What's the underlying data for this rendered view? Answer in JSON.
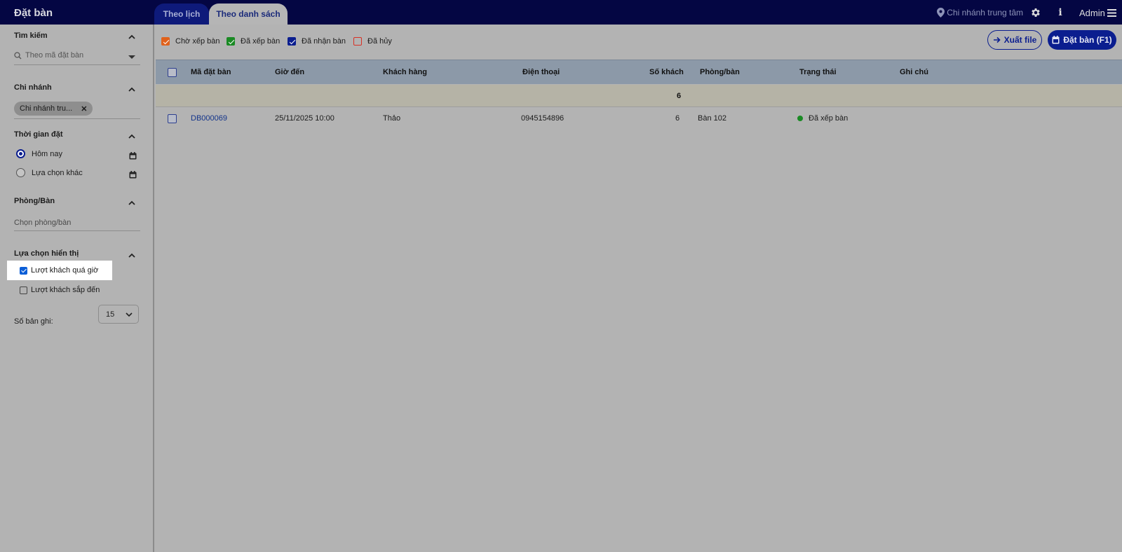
{
  "app": {
    "title": "Đặt bàn"
  },
  "tabs": [
    {
      "label": "Theo lịch",
      "active": false
    },
    {
      "label": "Theo danh sách",
      "active": true
    }
  ],
  "header": {
    "branch": "Chi nhánh trung tâm",
    "user": "Admin",
    "info_label": "i"
  },
  "sidebar": {
    "search": {
      "title": "Tìm kiếm",
      "placeholder": "Theo mã đặt bàn"
    },
    "branch": {
      "title": "Chi nhánh",
      "chip": "Chi nhánh tru..."
    },
    "time": {
      "title": "Thời gian đặt",
      "options": [
        {
          "label": "Hôm nay",
          "selected": true
        },
        {
          "label": "Lựa chọn khác",
          "selected": false
        }
      ]
    },
    "room": {
      "title": "Phòng/Bàn",
      "placeholder": "Chọn phòng/bàn"
    },
    "display": {
      "title": "Lựa chọn hiển thị",
      "options": [
        {
          "label": "Lượt khách quá giờ",
          "checked": true
        },
        {
          "label": "Lượt khách sắp đến",
          "checked": false
        }
      ]
    },
    "records": {
      "label": "Số bản ghi:",
      "value": "15"
    }
  },
  "status_filters": [
    {
      "label": "Chờ xếp bàn",
      "checked": true,
      "color": "#e0621c"
    },
    {
      "label": "Đã xếp bàn",
      "checked": true,
      "color": "#1a8a24"
    },
    {
      "label": "Đã nhận bàn",
      "checked": true,
      "color": "#0b1e8f"
    },
    {
      "label": "Đã hủy",
      "checked": false,
      "color": "#d93025"
    }
  ],
  "actions": {
    "export": "Xuất file",
    "book": "Đặt bàn (F1)"
  },
  "table": {
    "columns": [
      "Mã đặt bàn",
      "Giờ đến",
      "Khách hàng",
      "Điện thoại",
      "Số khách",
      "Phòng/bàn",
      "Trạng thái",
      "Ghi chú"
    ],
    "summary": {
      "guests": "6"
    },
    "rows": [
      {
        "code": "DB000069",
        "arrival": "25/11/2025 10:00",
        "customer": "Thảo",
        "phone": "0945154896",
        "guests": "6",
        "table": "Bàn 102",
        "status": "Đã xếp bàn",
        "status_color": "#1a8a24",
        "note": ""
      }
    ]
  }
}
